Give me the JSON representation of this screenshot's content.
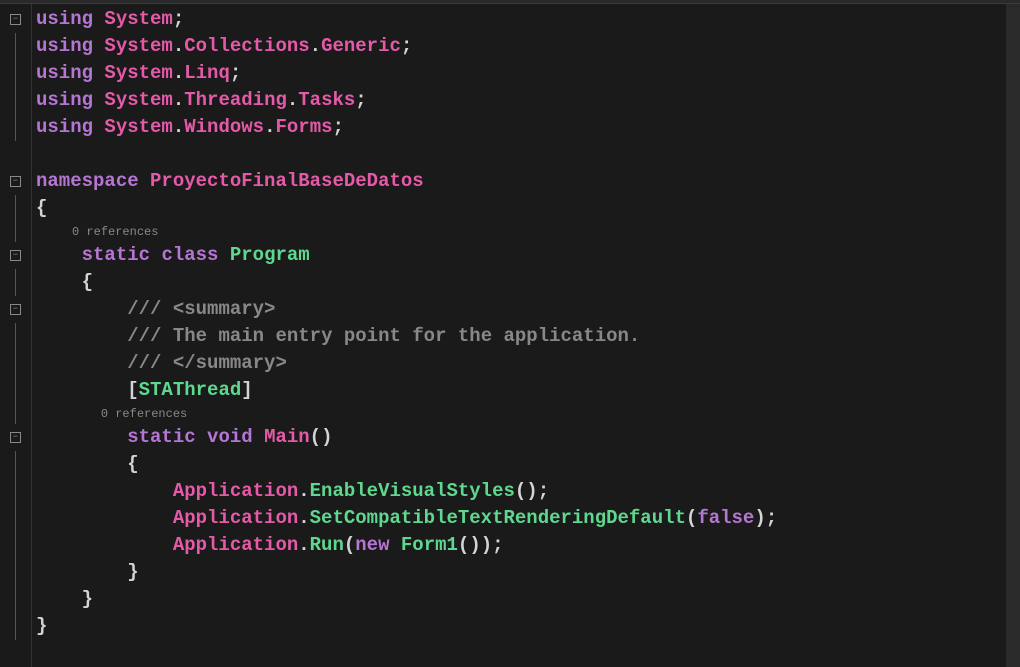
{
  "refs": {
    "class": "0 references",
    "method": "0 references"
  },
  "code": {
    "l1": {
      "kw": "using",
      "id": "System",
      "p": ";"
    },
    "l2": {
      "kw": "using",
      "id1": "System",
      "d1": ".",
      "id2": "Collections",
      "d2": ".",
      "id3": "Generic",
      "p": ";"
    },
    "l3": {
      "kw": "using",
      "id1": "System",
      "d1": ".",
      "id2": "Linq",
      "p": ";"
    },
    "l4": {
      "kw": "using",
      "id1": "System",
      "d1": ".",
      "id2": "Threading",
      "d2": ".",
      "id3": "Tasks",
      "p": ";"
    },
    "l5": {
      "kw": "using",
      "id1": "System",
      "d1": ".",
      "id2": "Windows",
      "d2": ".",
      "id3": "Forms",
      "p": ";"
    },
    "l7": {
      "kw": "namespace",
      "id": "ProyectoFinalBaseDeDatos"
    },
    "l8": "{",
    "l10": {
      "kw1": "static",
      "kw2": "class",
      "id": "Program"
    },
    "l11": "{",
    "l12": {
      "c": "///",
      "t": " <summary>"
    },
    "l13": {
      "c": "///",
      "t": " The main entry point for the application."
    },
    "l14": {
      "c": "///",
      "t": " </summary>"
    },
    "l15": {
      "b1": "[",
      "attr": "STAThread",
      "b2": "]"
    },
    "l17": {
      "kw1": "static",
      "kw2": "void",
      "id": "Main",
      "p": "()"
    },
    "l18": "{",
    "l19": {
      "id1": "Application",
      "d": ".",
      "m": "EnableVisualStyles",
      "p": "();"
    },
    "l20": {
      "id1": "Application",
      "d": ".",
      "m": "SetCompatibleTextRenderingDefault",
      "p1": "(",
      "kw": "false",
      "p2": ");"
    },
    "l21": {
      "id1": "Application",
      "d": ".",
      "m": "Run",
      "p1": "(",
      "kw": "new",
      "id2": "Form1",
      "p2": "());"
    },
    "l22": "}",
    "l23": "}",
    "l24": "}"
  },
  "fold": "−"
}
